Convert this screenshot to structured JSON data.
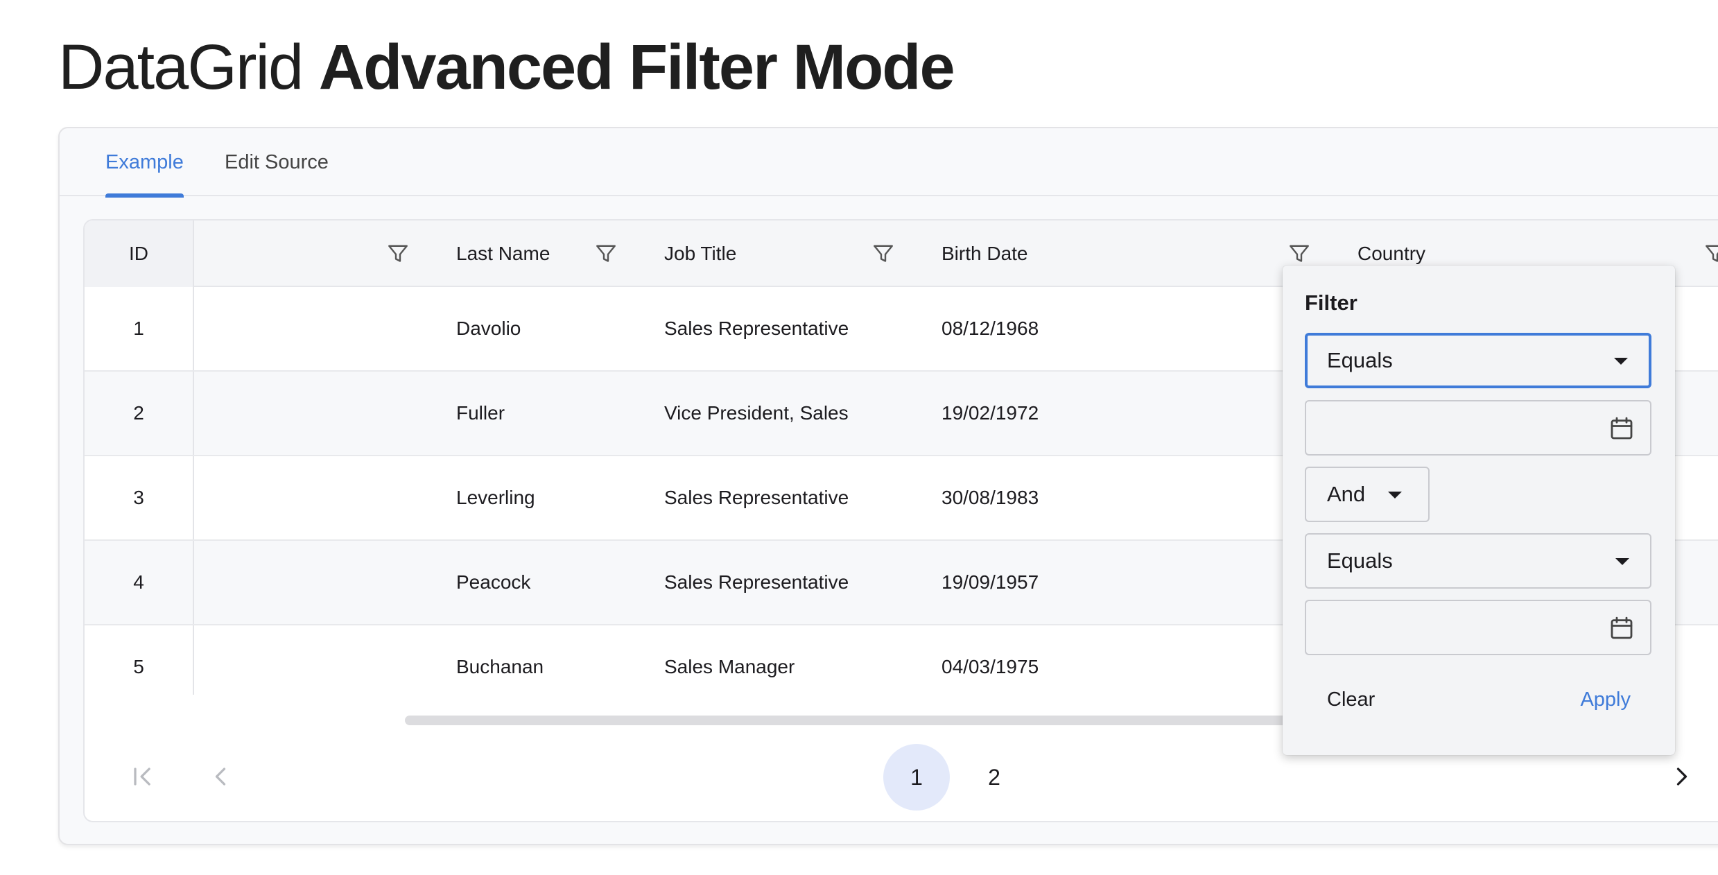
{
  "page": {
    "title_light": "DataGrid",
    "title_bold": "Advanced Filter Mode"
  },
  "tabs": [
    {
      "label": "Example",
      "active": true
    },
    {
      "label": "Edit Source",
      "active": false
    }
  ],
  "grid": {
    "columns": [
      "ID",
      "",
      "Last Name",
      "Job Title",
      "Birth Date",
      "Country"
    ],
    "rows": [
      {
        "id": "1",
        "last_name": "Davolio",
        "job_title": "Sales Representative",
        "birth_date": "08/12/1968"
      },
      {
        "id": "2",
        "last_name": "Fuller",
        "job_title": "Vice President, Sales",
        "birth_date": "19/02/1972"
      },
      {
        "id": "3",
        "last_name": "Leverling",
        "job_title": "Sales Representative",
        "birth_date": "30/08/1983"
      },
      {
        "id": "4",
        "last_name": "Peacock",
        "job_title": "Sales Representative",
        "birth_date": "19/09/1957"
      },
      {
        "id": "5",
        "last_name": "Buchanan",
        "job_title": "Sales Manager",
        "birth_date": "04/03/1975"
      }
    ]
  },
  "pager": {
    "pages": [
      "1",
      "2"
    ],
    "current": "1"
  },
  "filter_popup": {
    "title": "Filter",
    "operator_1": "Equals",
    "value_1": "",
    "logic": "And",
    "operator_2": "Equals",
    "value_2": "",
    "clear_label": "Clear",
    "apply_label": "Apply"
  },
  "colors": {
    "accent": "#3f7bd9",
    "current_page_bg": "#e3e9fa"
  },
  "icons": [
    "filter-icon",
    "calendar-icon",
    "first-page-icon",
    "previous-page-icon",
    "next-page-icon",
    "dropdown-caret-icon"
  ]
}
